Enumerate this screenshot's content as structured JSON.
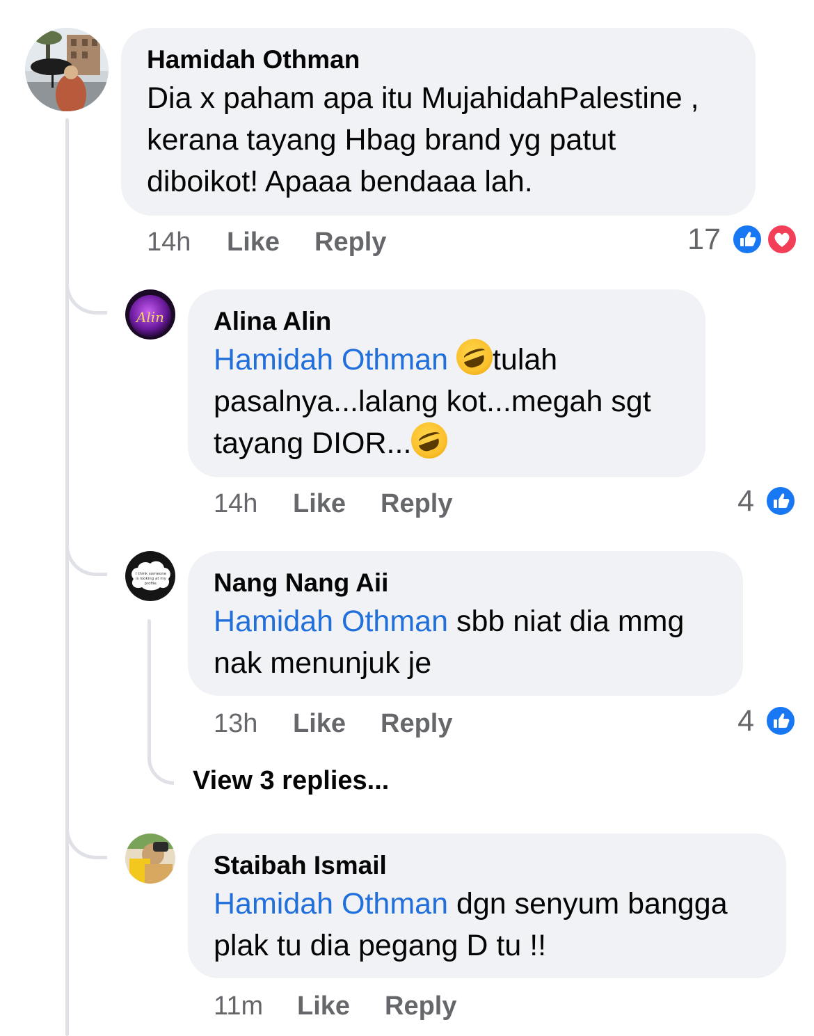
{
  "comments": [
    {
      "author": "Hamidah Othman",
      "lines": [
        "Dia x paham apa itu MujahidahPalestine ,",
        "kerana tayang Hbag brand yg patut",
        "diboikot! Apaaa bendaaa lah."
      ],
      "time": "14h",
      "like": "Like",
      "reply": "Reply",
      "reaction_count": "17",
      "reactions": [
        "like-icon",
        "love-icon"
      ]
    },
    {
      "author": "Alina Alin",
      "mention": "Hamidah Othman",
      "emoji": "rolling-on-floor-laughing",
      "line1_rest": "tulah",
      "line2": "pasalnya...lalang kot...megah sgt",
      "line3": "tayang DIOR...",
      "time": "14h",
      "like": "Like",
      "reply": "Reply",
      "reaction_count": "4",
      "reactions": [
        "like-icon"
      ],
      "avatar_text": "Alin"
    },
    {
      "author": "Nang Nang Aii",
      "mention": "Hamidah Othman",
      "line1_rest": " sbb niat dia mmg",
      "line2": "nak menunjuk je",
      "time": "13h",
      "like": "Like",
      "reply": "Reply",
      "reaction_count": "4",
      "reactions": [
        "like-icon"
      ],
      "avatar_text": "I think someone is looking at my profile."
    },
    {
      "author": "Staibah Ismail",
      "mention": "Hamidah Othman",
      "line1_rest": " dgn senyum bangga",
      "line2": "plak tu dia pegang D tu !!",
      "time": "11m",
      "like": "Like",
      "reply": "Reply"
    }
  ],
  "view_replies": "View 3 replies...",
  "colors": {
    "bubble": "#f0f2f5",
    "mention": "#216fdb",
    "meta": "#65676b",
    "like": "#1877f2",
    "love": "#f33e58"
  }
}
